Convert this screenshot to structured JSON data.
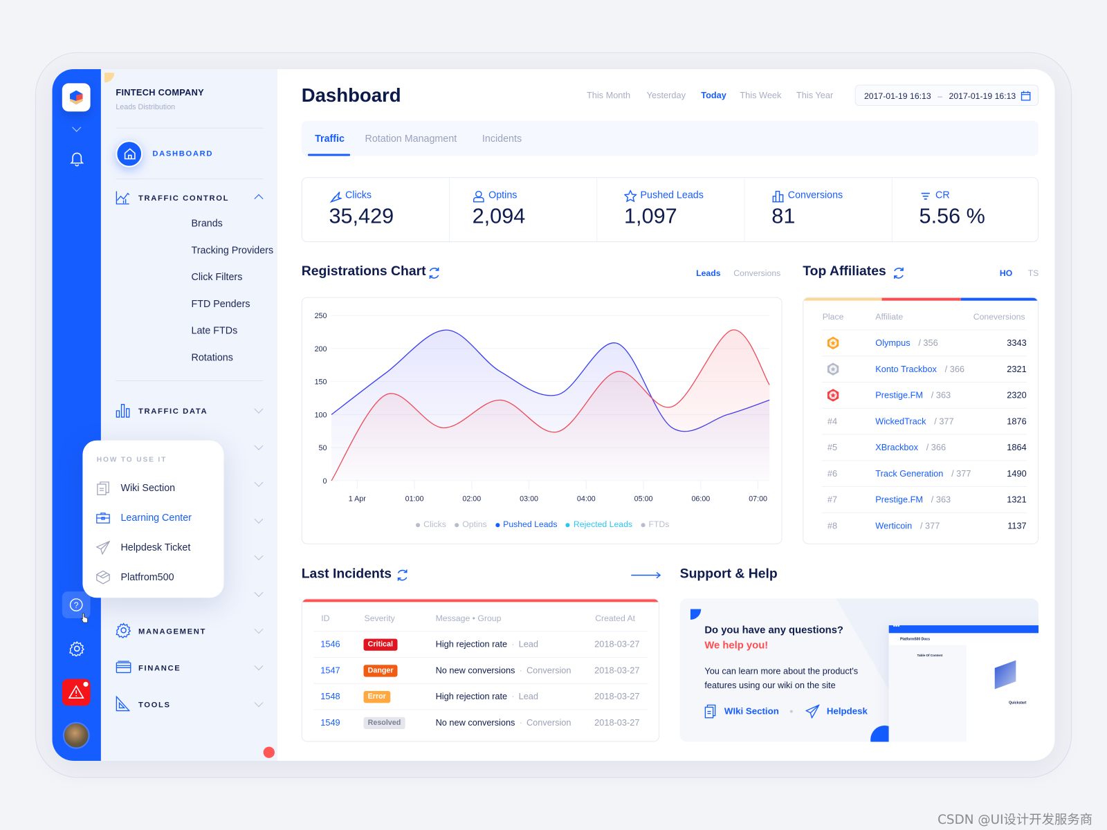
{
  "brand": {
    "company": "FINTECH COMPANY",
    "subtitle": "Leads Distribution"
  },
  "colors": {
    "accent": "#165dff",
    "danger": "#ff4d4f",
    "gold": "#ffb13d",
    "critical": "#e0141e",
    "dangerBadge": "#f25c12",
    "error": "#ffa940",
    "resolved": "#e4e6ec"
  },
  "rail": {
    "icons": [
      "logo-icon",
      "chevron-down-icon",
      "bell-icon",
      "help-icon",
      "gear-icon",
      "alert-icon",
      "avatar"
    ]
  },
  "sidebar": {
    "dashboard": "DASHBOARD",
    "traffic_control": {
      "label": "TRAFFIC CONTROL",
      "items": [
        "Brands",
        "Tracking Providers",
        "Click Filters",
        "FTD Penders",
        "Late FTDs",
        "Rotations"
      ]
    },
    "traffic_data": "TRAFFIC DATA",
    "management": "MANAGEMENT",
    "finance": "FINANCE",
    "tools": "TOOLS"
  },
  "popup": {
    "heading": "HOW TO USE IT",
    "items": [
      {
        "label": "Wiki Section",
        "icon": "wiki-icon"
      },
      {
        "label": "Learning Center",
        "icon": "briefcase-icon"
      },
      {
        "label": "Helpdesk Ticket",
        "icon": "paper-plane-icon"
      },
      {
        "label": "Platfrom500",
        "icon": "cube-icon"
      }
    ]
  },
  "header": {
    "title": "Dashboard",
    "filters": [
      "This Month",
      "Yesterday",
      "Today",
      "This Week",
      "This Year"
    ],
    "active_filter": "Today",
    "date_from": "2017-01-19 16:13",
    "date_sep": "–",
    "date_to": "2017-01-19 16:13"
  },
  "tabs": [
    "Traffic",
    "Rotation Managment",
    "Incidents"
  ],
  "stats": [
    {
      "label": "Clicks",
      "value": "35,429",
      "icon": "cursor-icon"
    },
    {
      "label": "Optins",
      "value": "2,094",
      "icon": "user-icon"
    },
    {
      "label": "Pushed Leads",
      "value": "1,097",
      "icon": "star-icon"
    },
    {
      "label": "Conversions",
      "value": "81",
      "icon": "bar-chart-icon"
    },
    {
      "label": "CR",
      "value": "5.56 %",
      "icon": "filter-icon"
    }
  ],
  "registrations": {
    "title": "Registrations Chart",
    "toggles": [
      "Leads",
      "Conversions"
    ],
    "active": "Leads"
  },
  "chart_data": {
    "type": "area",
    "ylim": [
      0,
      250
    ],
    "yticks": [
      "0",
      "50",
      "100",
      "150",
      "200",
      "250"
    ],
    "xticks": [
      "1 Apr",
      "01:00",
      "02:00",
      "03:00",
      "04:00",
      "05:00",
      "06:00",
      "07:00"
    ],
    "legend": [
      {
        "name": "Clicks",
        "color": "#b8bdcc"
      },
      {
        "name": "Optins",
        "color": "#b8bdcc"
      },
      {
        "name": "Pushed Leads",
        "color": "#165dff"
      },
      {
        "name": "Rejected Leads",
        "color": "#2ec4f0"
      },
      {
        "name": "FTDs",
        "color": "#b8bdcc"
      }
    ],
    "legend_position": "bottom",
    "series": [
      {
        "name": "Pushed Leads",
        "color": "#3a3ff0",
        "points": [
          [
            "31 Mar 23:33",
            100
          ],
          [
            "1 Apr 00:30",
            163
          ],
          [
            "1 Apr 01:33",
            228
          ],
          [
            "1 Apr 02:30",
            165
          ],
          [
            "1 Apr 03:30",
            130
          ],
          [
            "1 Apr 04:32",
            208
          ],
          [
            "1 Apr 05:30",
            80
          ],
          [
            "1 Apr 06:28",
            100
          ],
          [
            "1 Apr 07:12",
            122
          ]
        ]
      },
      {
        "name": "Rejected Leads",
        "color": "#ec4c5c",
        "points": [
          [
            "31 Mar 23:33",
            0
          ],
          [
            "1 Apr 00:30",
            130
          ],
          [
            "1 Apr 01:30",
            80
          ],
          [
            "1 Apr 02:30",
            122
          ],
          [
            "1 Apr 03:30",
            74
          ],
          [
            "1 Apr 04:32",
            165
          ],
          [
            "1 Apr 05:30",
            112
          ],
          [
            "1 Apr 06:33",
            228
          ],
          [
            "1 Apr 07:12",
            145
          ]
        ]
      }
    ]
  },
  "affiliates": {
    "title": "Top Affiliates",
    "toggles": [
      "HO",
      "TS"
    ],
    "active": "HO",
    "columns": [
      "Place",
      "Affiliate",
      "Coneversions"
    ],
    "rows": [
      {
        "place": "gold-medal",
        "name": "Olympus",
        "id": "/ 356",
        "conv": "3343"
      },
      {
        "place": "silver-medal",
        "name": "Konto Trackbox",
        "id": "/ 366",
        "conv": "2321"
      },
      {
        "place": "red-medal",
        "name": "Prestige.FM",
        "id": "/ 363",
        "conv": "2320"
      },
      {
        "place": "#4",
        "name": "WickedTrack",
        "id": "/ 377",
        "conv": "1876"
      },
      {
        "place": "#5",
        "name": "XBrackbox",
        "id": "/ 366",
        "conv": "1864"
      },
      {
        "place": "#6",
        "name": "Track Generation",
        "id": "/ 377",
        "conv": "1490"
      },
      {
        "place": "#7",
        "name": "Prestige.FM",
        "id": "/ 363",
        "conv": "1321"
      },
      {
        "place": "#8",
        "name": "Werticoin",
        "id": "/ 377",
        "conv": "1137"
      }
    ]
  },
  "incidents": {
    "title": "Last Incidents",
    "columns": [
      "ID",
      "Severity",
      "Message • Group",
      "Created At"
    ],
    "rows": [
      {
        "id": "1546",
        "severity": "Critical",
        "msg": "High rejection rate",
        "group": "Lead",
        "date": "2018-03-27"
      },
      {
        "id": "1547",
        "severity": "Danger",
        "msg": "No new conversions",
        "group": "Conversion",
        "date": "2018-03-27"
      },
      {
        "id": "1548",
        "severity": "Error",
        "msg": "High rejection rate",
        "group": "Lead",
        "date": "2018-03-27"
      },
      {
        "id": "1549",
        "severity": "Resolved",
        "msg": "No new conversions",
        "group": "Conversion",
        "date": "2018-03-27"
      }
    ]
  },
  "support": {
    "title": "Support & Help",
    "q": "Do you have any questions?",
    "help": "We help you!",
    "text1": "You can learn more about the product's",
    "text2": "features using our wiki on the site",
    "wiki": "WIki Section",
    "helpdesk": "Helpdesk",
    "preview_brand": "Platform500 Docs",
    "preview_toc": "Table Of Content",
    "preview_quick": "Quickstart"
  },
  "watermark": "CSDN @UI设计开发服务商"
}
